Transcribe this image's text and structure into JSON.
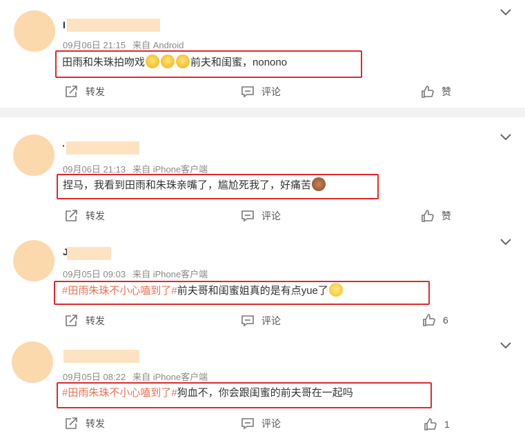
{
  "comments": [
    {
      "name_glyph": "I",
      "date": "09月06日 21:15",
      "source": "来自 Android",
      "text_segments": [
        {
          "text": "田雨和朱珠拍吻戏",
          "type": "plain"
        },
        {
          "emoji": "cry"
        },
        {
          "emoji": "cry"
        },
        {
          "emoji": "cry"
        },
        {
          "text": "前夫和闺蜜，nonono",
          "type": "plain"
        }
      ],
      "repost_label": "转发",
      "comment_label": "评论",
      "like_label": "赞"
    },
    {
      "name_glyph": "·",
      "date": "09月06日 21:13",
      "source": "来自 iPhone客户端",
      "text_segments": [
        {
          "text": "捏马，我看到田雨和朱珠亲嘴了，尴尬死我了，好痛苦",
          "type": "plain"
        },
        {
          "emoji": "bear"
        }
      ],
      "repost_label": "转发",
      "comment_label": "评论",
      "like_label": "赞"
    },
    {
      "name_glyph": "J",
      "date": "09月05日 09:03",
      "source": "来自 iPhone客户端",
      "text_segments": [
        {
          "text": "#田雨朱珠不小心嗑到了#",
          "type": "tag"
        },
        {
          "text": "前夫哥和闺蜜姐真的是有点yue了",
          "type": "plain"
        },
        {
          "emoji": "sad"
        }
      ],
      "repost_label": "转发",
      "comment_label": "评论",
      "like_label": "6"
    },
    {
      "name_glyph": "",
      "date": "09月05日 08:22",
      "source": "来自 iPhone客户端",
      "text_segments": [
        {
          "text": "#田雨朱珠不小心嗑到了#",
          "type": "tag"
        },
        {
          "text": "狗血不，你会跟闺蜜的前夫哥在一起吗",
          "type": "plain"
        }
      ],
      "repost_label": "转发",
      "comment_label": "评论",
      "like_label": "1"
    }
  ],
  "colors": {
    "highlight_box": "#e0282d",
    "topic_link": "#eb7350",
    "avatar_placeholder": "#fcd9ad",
    "separator": "#f2f2f2"
  }
}
